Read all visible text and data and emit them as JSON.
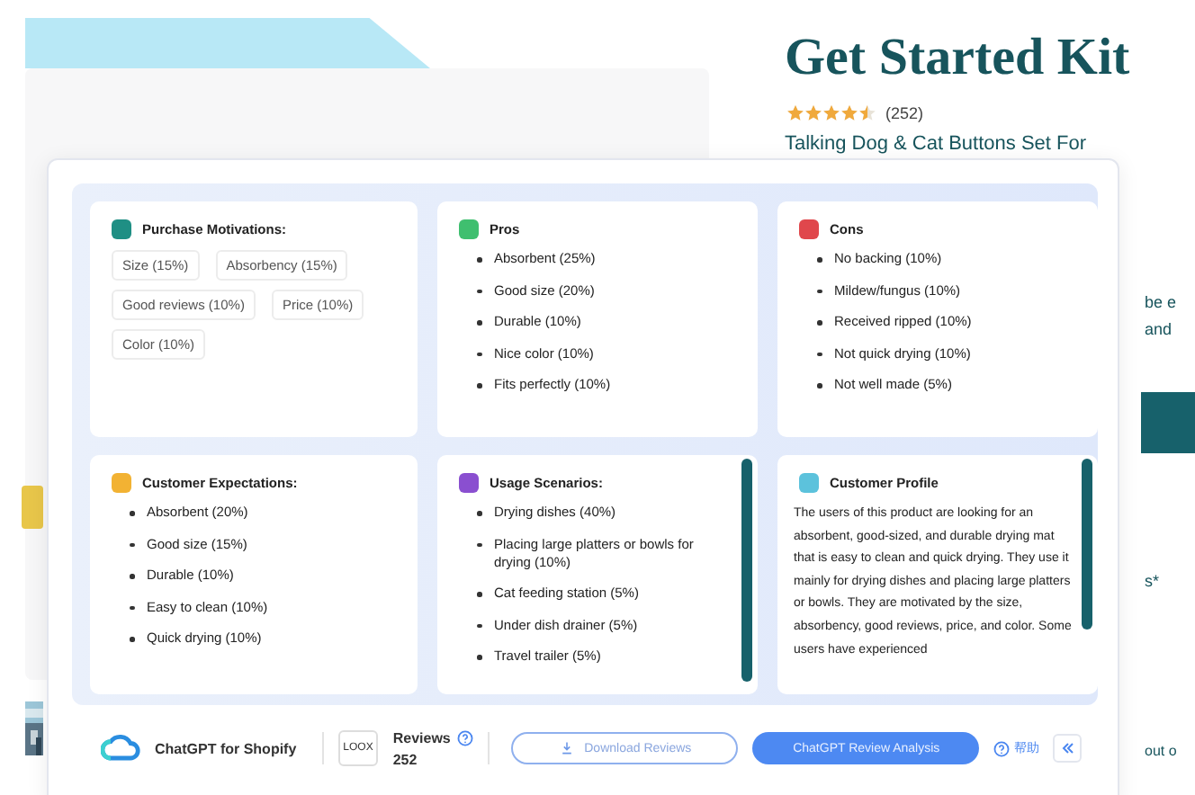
{
  "page": {
    "title": "Get Started Kit",
    "stars": 4.5,
    "rating_count": "(252)",
    "subtitle": "Talking Dog & Cat Buttons Set For",
    "side_fragments": [
      "be e",
      "and",
      "s*",
      "out o"
    ]
  },
  "cards": [
    {
      "kind": "tags",
      "title": "Purchase Motivations:",
      "color": "#1f8f84",
      "items": [
        "Size (15%)",
        "Absorbency (15%)",
        "Good reviews (10%)",
        "Price (10%)",
        "Color (10%)"
      ]
    },
    {
      "kind": "bullets",
      "title": "Pros",
      "color": "#3fbf6f",
      "items": [
        "Absorbent (25%)",
        "Good size (20%)",
        "Durable (10%)",
        "Nice color (10%)",
        "Fits perfectly (10%)"
      ]
    },
    {
      "kind": "bullets",
      "title": "Cons",
      "color": "#e0474c",
      "items": [
        "No backing (10%)",
        "Mildew/fungus (10%)",
        "Received ripped (10%)",
        "Not quick drying (10%)",
        "Not well made (5%)"
      ]
    },
    {
      "kind": "bullets",
      "title": "Customer Expectations:",
      "color": "#f2b233",
      "items": [
        "Absorbent (20%)",
        "Good size (15%)",
        "Durable (10%)",
        "Easy to clean (10%)",
        "Quick drying (10%)"
      ]
    },
    {
      "kind": "bullets",
      "title": "Usage Scenarios:",
      "color": "#8a4fd0",
      "scrollbar": true,
      "items": [
        "Drying dishes (40%)",
        "Placing large platters or bowls for drying (10%)",
        "Cat feeding station (5%)",
        "Under dish drainer (5%)",
        "Travel trailer (5%)"
      ]
    },
    {
      "kind": "paragraph",
      "title": "Customer Profile",
      "color": "#5cc2dc",
      "scrollbar": true,
      "text": "The users of this product are looking for an absorbent, good-sized, and durable drying mat that is easy to clean and quick drying. They use it mainly for drying dishes and placing large platters or bowls. They are motivated by the size, absorbency, good reviews, price, and color. Some users have experienced"
    }
  ],
  "footer": {
    "brand": "ChatGPT for Shopify",
    "loox": "LOOX",
    "reviews_label": "Reviews",
    "reviews_count": "252",
    "download": "Download Reviews",
    "analyze": "ChatGPT Review Analysis",
    "help": "帮助"
  }
}
